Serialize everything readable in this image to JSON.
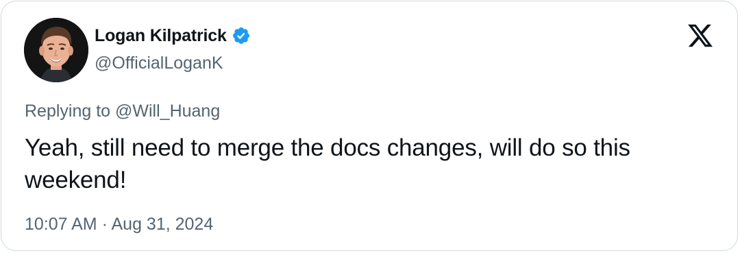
{
  "author": {
    "display_name": "Logan Kilpatrick",
    "handle": "@OfficialLoganK",
    "verified": true,
    "avatar_icon": "profile-photo"
  },
  "platform": {
    "logo_icon": "x-logo-icon"
  },
  "reply": {
    "prefix": "Replying to ",
    "mention": "@Will_Huang"
  },
  "tweet": {
    "text": "Yeah, still need to merge the docs changes, will do so this weekend!"
  },
  "meta": {
    "time": "10:07 AM",
    "separator": " · ",
    "date": "Aug 31, 2024"
  },
  "colors": {
    "verified_badge": "#1d9bf0",
    "secondary_text": "#536471",
    "primary_text": "#0f1419",
    "border": "#cfd9de"
  }
}
